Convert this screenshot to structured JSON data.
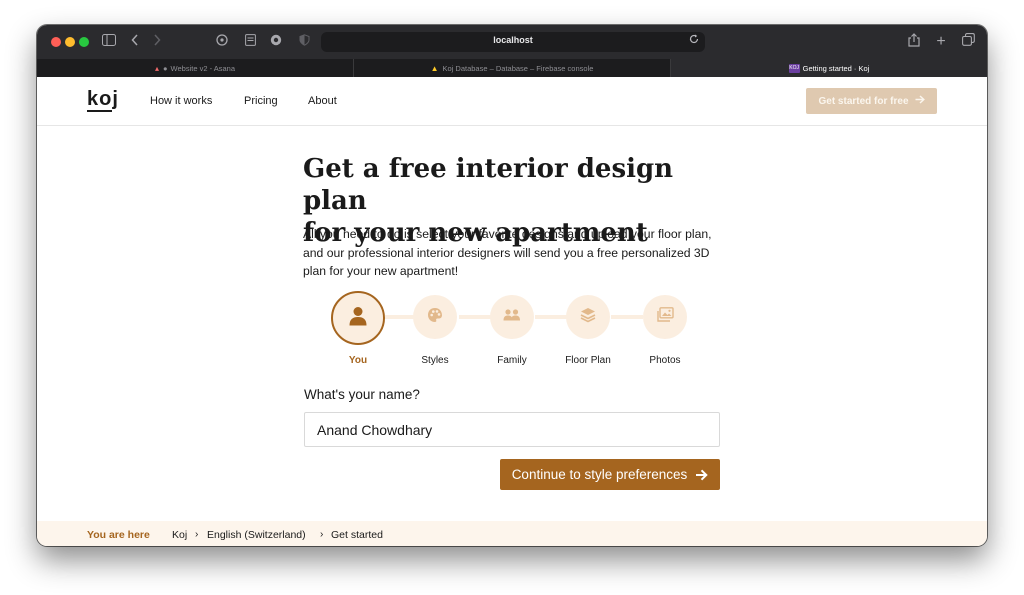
{
  "browser": {
    "url": "localhost",
    "tabs": [
      {
        "label": "Website v2 - Asana",
        "favicon": "asana-icon",
        "active": false
      },
      {
        "label": "Koj Database – Database – Firebase console",
        "favicon": "firebase-icon",
        "active": false
      },
      {
        "label": "Getting started · Koj",
        "favicon": "koj-icon",
        "active": true
      }
    ]
  },
  "nav": {
    "logo": "koj",
    "links": [
      "How it works",
      "Pricing",
      "About"
    ],
    "cta": "Get started for free"
  },
  "hero": {
    "title_line1": "Get a free interior design plan",
    "title_line2": "for your new apartment",
    "subtitle": "All you need to do is select your favorite designs and upload your floor plan, and our professional interior designers will send you a free personalized 3D plan for your new apartment!"
  },
  "steps": [
    {
      "label": "You",
      "icon": "user-icon",
      "active": true
    },
    {
      "label": "Styles",
      "icon": "palette-icon",
      "active": false
    },
    {
      "label": "Family",
      "icon": "family-icon",
      "active": false
    },
    {
      "label": "Floor Plan",
      "icon": "layers-icon",
      "active": false
    },
    {
      "label": "Photos",
      "icon": "photos-icon",
      "active": false
    }
  ],
  "form": {
    "question": "What's your name?",
    "name_value": "Anand Chowdhary",
    "continue_label": "Continue to style preferences"
  },
  "breadcrumb": {
    "label": "You are here",
    "items": [
      "Koj",
      "English (Switzerland)",
      "Get started"
    ]
  },
  "colors": {
    "accent": "#a5651f",
    "accent_light": "#fbeee0",
    "cta_disabled": "#dfc9b0"
  }
}
